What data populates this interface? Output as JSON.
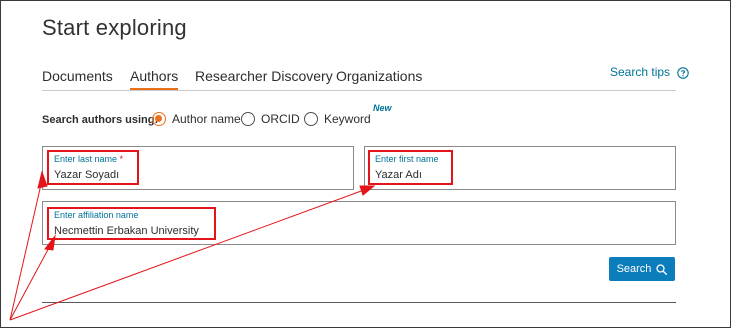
{
  "page": {
    "title": "Start exploring"
  },
  "tabs": [
    {
      "label": "Documents",
      "active": false
    },
    {
      "label": "Authors",
      "active": true
    },
    {
      "label": "Researcher Discovery",
      "active": false
    },
    {
      "label": "Organizations",
      "active": false
    }
  ],
  "search_tips": {
    "label": "Search tips",
    "icon": "help-circle-icon"
  },
  "new_badge": "New",
  "search_using": {
    "label": "Search authors using:",
    "options": [
      {
        "label": "Author name",
        "selected": true
      },
      {
        "label": "ORCID",
        "selected": false
      },
      {
        "label": "Keyword",
        "selected": false
      }
    ]
  },
  "fields": {
    "last_name": {
      "label": "Enter last name",
      "required_mark": "*",
      "value": "Yazar Soyadı"
    },
    "first_name": {
      "label": "Enter first name",
      "value": "Yazar Adı"
    },
    "affiliation": {
      "label": "Enter affiliation name",
      "value": "Necmettin Erbakan University"
    }
  },
  "search_button": {
    "label": "Search",
    "icon": "search-icon"
  },
  "colors": {
    "accent": "#e9711c",
    "link": "#007398",
    "button": "#0c7dbb",
    "annotation": "#e3151a"
  }
}
